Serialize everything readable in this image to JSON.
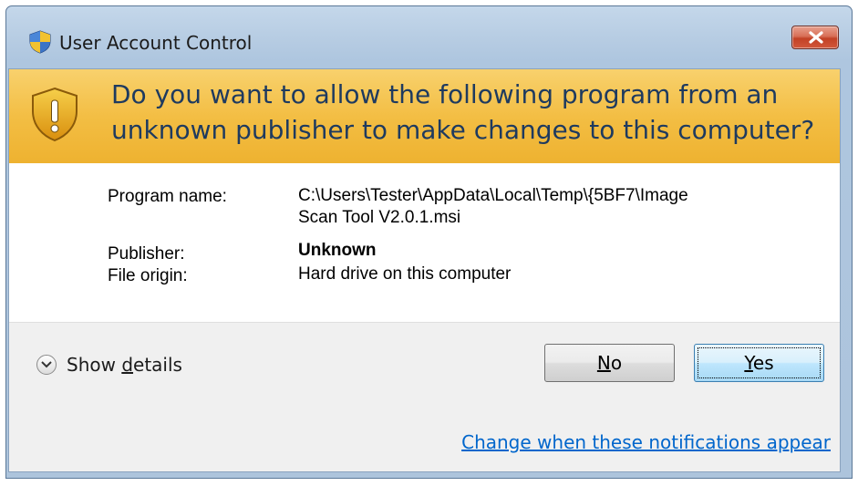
{
  "titlebar": {
    "title": "User Account Control",
    "icon": "uac-shield-icon",
    "close_icon": "close-icon"
  },
  "banner": {
    "icon": "warning-shield-icon",
    "question_line1": "Do you want to allow the following program from an",
    "question_line2": "unknown publisher to make changes to this computer?"
  },
  "details": {
    "program_name_label": "Program name:",
    "program_name_value_line1": "C:\\Users\\Tester\\AppData\\Local\\Temp\\{5BF7\\Image",
    "program_name_value_line2": "Scan Tool V2.0.1.msi",
    "publisher_label": "Publisher:",
    "publisher_value": "Unknown",
    "file_origin_label": "File origin:",
    "file_origin_value": "Hard drive on this computer"
  },
  "footer": {
    "show_details_pre": "Show ",
    "show_details_accel": "d",
    "show_details_post": "etails",
    "expander_icon": "chevron-down-icon",
    "no_accel": "N",
    "no_rest": "o",
    "yes_accel": "Y",
    "yes_rest": "es",
    "change_link": "Change when these notifications appear"
  },
  "colors": {
    "banner": "#f3be44",
    "banner_text": "#1e3a5f",
    "link": "#0066cc",
    "close_button": "#c24126"
  }
}
